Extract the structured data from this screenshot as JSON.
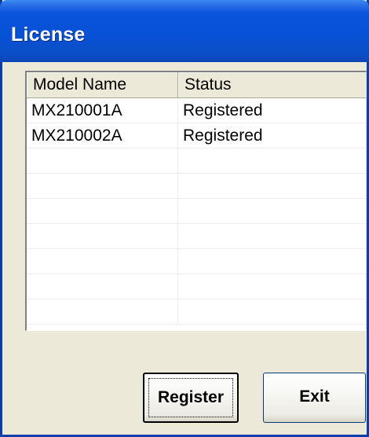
{
  "window": {
    "title": "License"
  },
  "list": {
    "columns": [
      "Model Name",
      "Status"
    ],
    "rows": [
      [
        "MX210001A",
        "Registered"
      ],
      [
        "MX210002A",
        "Registered"
      ],
      [
        "",
        ""
      ],
      [
        "",
        ""
      ],
      [
        "",
        ""
      ],
      [
        "",
        ""
      ],
      [
        "",
        ""
      ],
      [
        "",
        ""
      ],
      [
        "",
        ""
      ]
    ]
  },
  "buttons": {
    "register_label": "Register",
    "exit_label": "Exit"
  },
  "colors": {
    "titlebar": "#0651d6",
    "frame": "#0a3ea8",
    "face": "#ece9d8"
  }
}
